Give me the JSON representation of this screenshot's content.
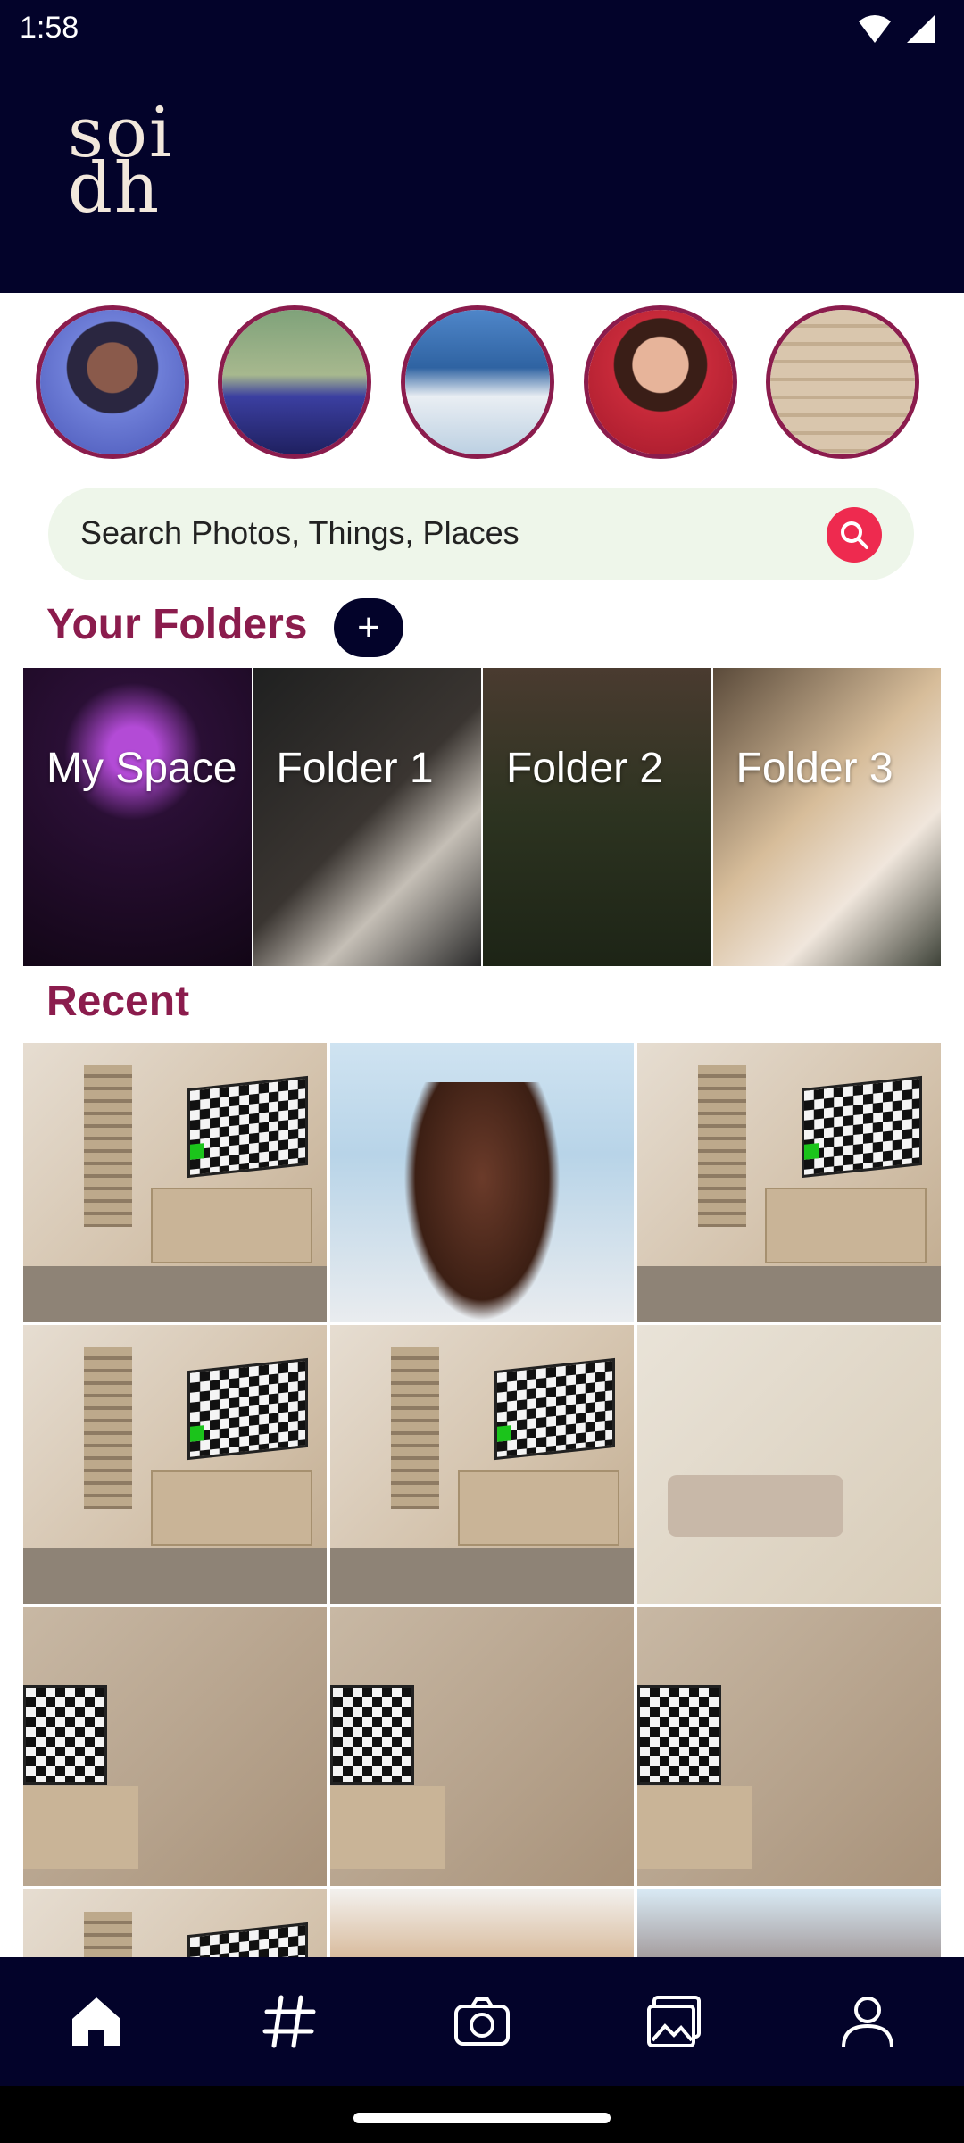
{
  "status_bar": {
    "time": "1:58"
  },
  "header": {
    "logo_line1": "soi",
    "logo_line2": "dh"
  },
  "stories": [
    {
      "name": "story-avatar-1"
    },
    {
      "name": "story-avatar-2"
    },
    {
      "name": "story-avatar-3"
    },
    {
      "name": "story-avatar-4"
    },
    {
      "name": "story-avatar-5"
    }
  ],
  "search": {
    "placeholder": "Search Photos, Things, Places"
  },
  "folders_section": {
    "title": "Your Folders",
    "add_label": "+",
    "folders": [
      {
        "label": "My Space"
      },
      {
        "label": "Folder 1"
      },
      {
        "label": "Folder 2"
      },
      {
        "label": "Folder 3"
      }
    ]
  },
  "recent_section": {
    "title": "Recent"
  },
  "bottom_nav": [
    {
      "icon": "home-icon"
    },
    {
      "icon": "hashtag-icon"
    },
    {
      "icon": "camera-icon"
    },
    {
      "icon": "gallery-icon"
    },
    {
      "icon": "profile-icon"
    }
  ],
  "colors": {
    "header_bg": "#03032a",
    "accent": "#8b1c4d",
    "search_bg": "#eef6ea",
    "search_button": "#ee2a4f"
  }
}
